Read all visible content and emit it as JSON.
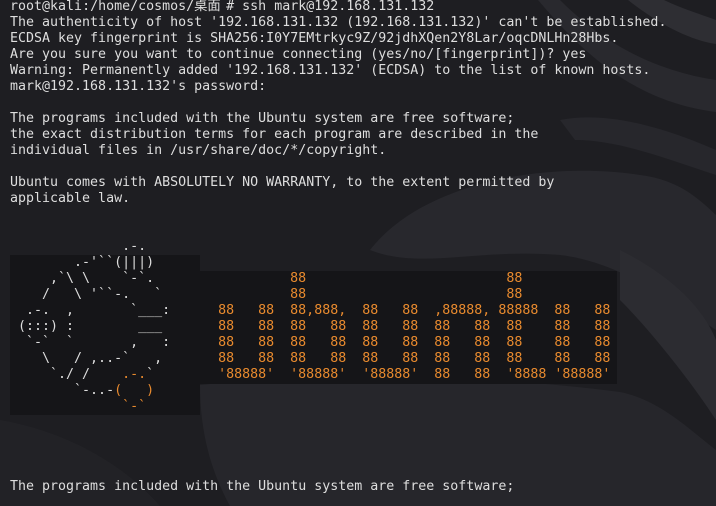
{
  "colors": {
    "background": "#1e1e22",
    "text": "#dedede",
    "ubuntu_orange": "#e88a2e",
    "block_background": "#151518"
  },
  "terminal": {
    "prompt": {
      "user_host": "root@kali",
      "path": ":/home/cosmos/",
      "path_folder": "桌面",
      "symbol": "#"
    },
    "command": "ssh mark@192.168.131.132",
    "ssh_output": [
      "The authenticity of host '192.168.131.132 (192.168.131.132)' can't be established.",
      "ECDSA key fingerprint is SHA256:I0Y7EMtrkyc9Z/92jdhXQen2Y8Lar/oqcDNLHn28Hbs.",
      "Are you sure you want to continue connecting (yes/no/[fingerprint])? yes",
      "Warning: Permanently added '192.168.131.132' (ECDSA) to the list of known hosts.",
      "mark@192.168.131.132's password: "
    ],
    "motd_license": [
      "The programs included with the Ubuntu system are free software;",
      "the exact distribution terms for each program are described in the",
      "individual files in /usr/share/doc/*/copyright."
    ],
    "motd_warranty": [
      "Ubuntu comes with ABSOLUTELY NO WARRANTY, to the extent permitted by",
      "applicable law."
    ],
    "logo": [
      {
        "art": "              .-."
      },
      {
        "art": "        .-'``(|||)"
      },
      {
        "art": "     ,`\\ \\    `-`."
      },
      {
        "art": "    /   \\ '``-.   `"
      },
      {
        "art": "  .-.  ,       `___:"
      },
      {
        "art": " (:::) :        ___"
      },
      {
        "art": "  `-`  `       ,   :"
      },
      {
        "art": "    \\   / ,..-`   ,"
      },
      {
        "art": "     `./ /    ",
        "head": ".-.",
        "tail": "`"
      },
      {
        "art": "        `-..-",
        "head": "(   )"
      },
      {
        "art": "              ",
        "head": "`-`"
      }
    ],
    "wordmark": [
      "         88                         88",
      "         88                         88",
      "88   88  88,888,  88   88  ,88888, 88888  88   88",
      "88   88  88   88  88   88  88   88  88    88   88",
      "88   88  88   88  88   88  88   88  88    88   88",
      "88   88  88   88  88   88  88   88  88    88   88",
      "'88888'  '88888'  '88888'  88   88  '8888 '88888'"
    ],
    "repeated_license_line": "The programs included with the Ubuntu system are free software;"
  }
}
